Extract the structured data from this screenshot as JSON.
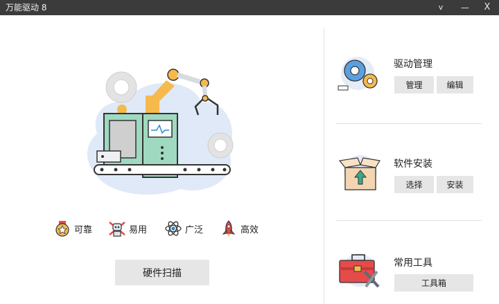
{
  "window": {
    "title": "万能驱动 8",
    "menu_glyph": "v",
    "minimize_glyph": "—",
    "close_glyph": "X"
  },
  "features": [
    {
      "label": "可靠",
      "icon": "medal-icon"
    },
    {
      "label": "易用",
      "icon": "robot-icon"
    },
    {
      "label": "广泛",
      "icon": "atom-icon"
    },
    {
      "label": "高效",
      "icon": "rocket-icon"
    }
  ],
  "scan_button": "硬件扫描",
  "sections": {
    "driver": {
      "title": "驱动管理",
      "icon": "gears-icon",
      "buttons": [
        "管理",
        "编辑"
      ]
    },
    "software": {
      "title": "软件安装",
      "icon": "box-icon",
      "buttons": [
        "选择",
        "安装"
      ]
    },
    "tools": {
      "title": "常用工具",
      "icon": "toolbox-icon",
      "buttons": [
        "工具箱"
      ]
    }
  },
  "colors": {
    "titlebar": "#3b3b3b",
    "button": "#e6e6e6",
    "machine_green": "#9fd9c0",
    "machine_blue": "#dfe9f7",
    "accent_orange": "#f6b94c"
  }
}
